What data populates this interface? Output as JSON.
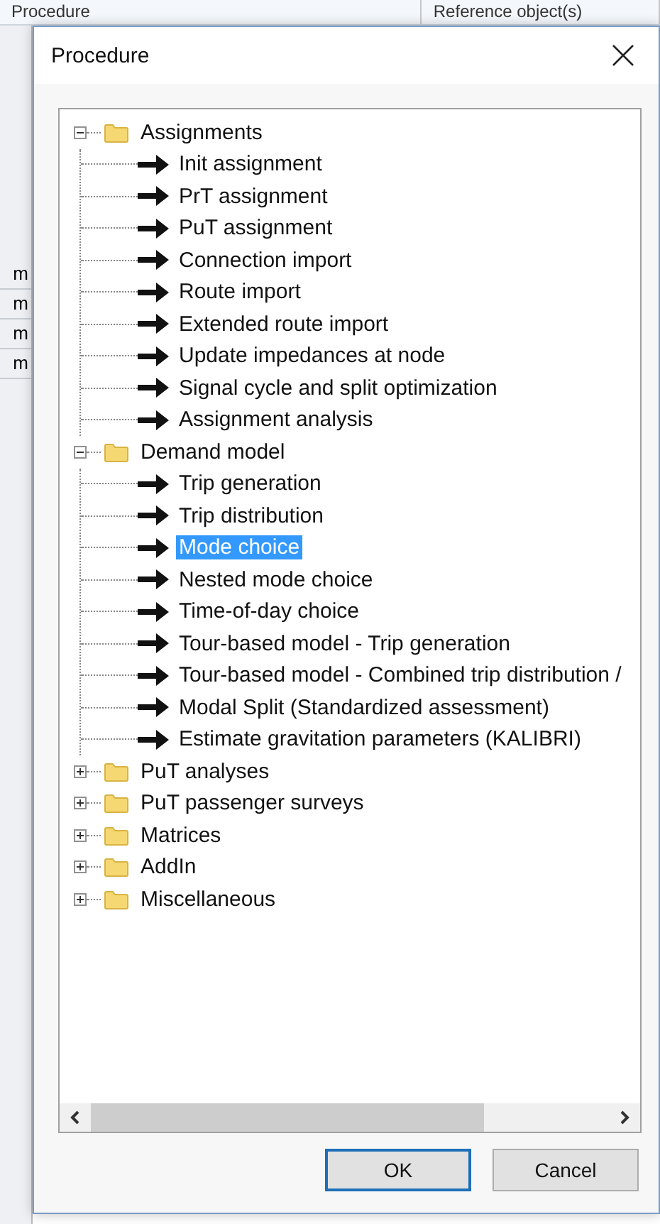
{
  "background": {
    "header": [
      "Procedure",
      "Reference object(s)"
    ],
    "side_cells": [
      "m",
      "m",
      "m",
      "m"
    ]
  },
  "dialog": {
    "title": "Procedure",
    "tree": [
      {
        "label": "Assignments",
        "expanded": true,
        "selected": false,
        "children": [
          {
            "label": "Init assignment",
            "selected": false
          },
          {
            "label": "PrT assignment",
            "selected": false
          },
          {
            "label": "PuT assignment",
            "selected": false
          },
          {
            "label": "Connection import",
            "selected": false
          },
          {
            "label": "Route import",
            "selected": false
          },
          {
            "label": "Extended route import",
            "selected": false
          },
          {
            "label": "Update impedances at node",
            "selected": false
          },
          {
            "label": "Signal cycle and split optimization",
            "selected": false
          },
          {
            "label": "Assignment analysis",
            "selected": false
          }
        ]
      },
      {
        "label": "Demand model",
        "expanded": true,
        "selected": false,
        "children": [
          {
            "label": "Trip generation",
            "selected": false
          },
          {
            "label": "Trip distribution",
            "selected": false
          },
          {
            "label": "Mode choice",
            "selected": true
          },
          {
            "label": "Nested mode choice",
            "selected": false
          },
          {
            "label": "Time-of-day choice",
            "selected": false
          },
          {
            "label": "Tour-based model - Trip generation",
            "selected": false
          },
          {
            "label": "Tour-based model - Combined trip distribution /",
            "selected": false
          },
          {
            "label": "Modal Split (Standardized assessment)",
            "selected": false
          },
          {
            "label": "Estimate gravitation parameters (KALIBRI)",
            "selected": false
          }
        ]
      },
      {
        "label": "PuT analyses",
        "expanded": false,
        "selected": false
      },
      {
        "label": "PuT passenger surveys",
        "expanded": false,
        "selected": false
      },
      {
        "label": "Matrices",
        "expanded": false,
        "selected": false
      },
      {
        "label": "AddIn",
        "expanded": false,
        "selected": false
      },
      {
        "label": "Miscellaneous",
        "expanded": false,
        "selected": false
      }
    ],
    "buttons": [
      {
        "label": "OK",
        "default": true
      },
      {
        "label": "Cancel",
        "default": false
      }
    ]
  }
}
